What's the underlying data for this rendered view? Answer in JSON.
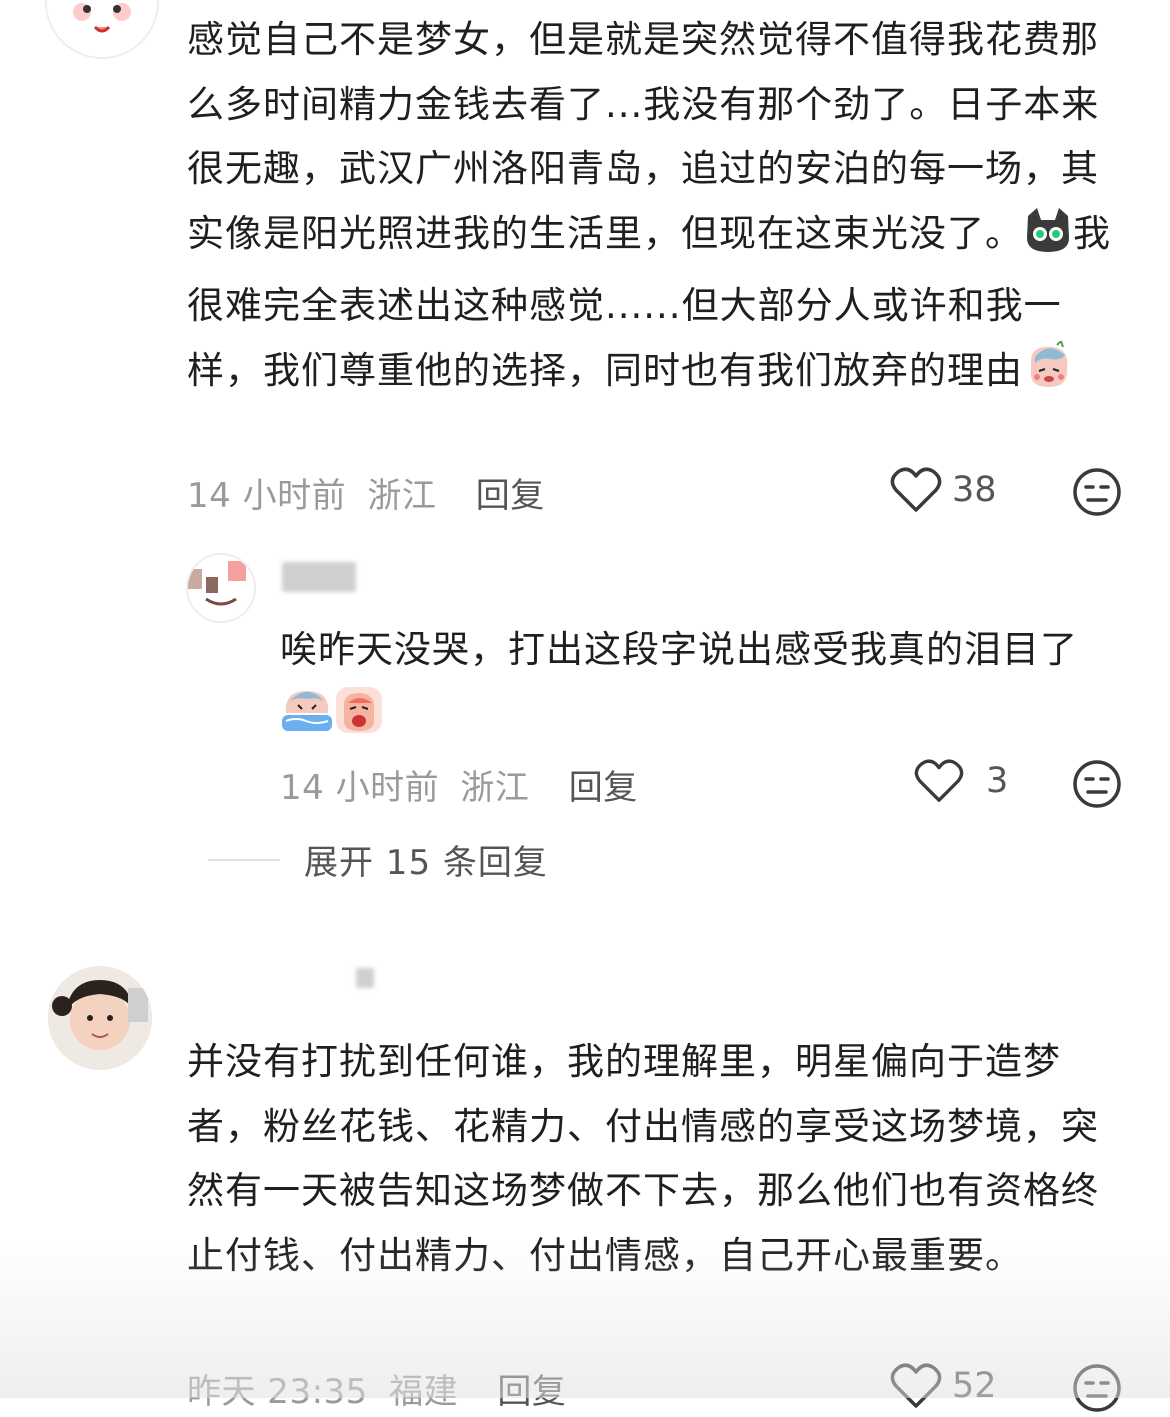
{
  "comment1": {
    "text_a": "感觉自己不是梦女，但是就是突然觉得不值得我花费那么多时间精力金钱去看了...我没有那个劲了。日子本来很无趣，武汉广州洛阳青岛，追过的安泊的每一场，其实像是阳光照进我的生活里，但现在这束光没了。",
    "text_b": "我很难完全表述出这种感觉......但大部分人或许和我一样，我们尊重他的选择，同时也有我们放弃的理由",
    "time": "14 小时前",
    "location": "浙江",
    "reply_label": "回复",
    "likes": "38",
    "like_icon": "heart-outline-icon",
    "dislike_icon": "neutral-face-icon"
  },
  "reply1": {
    "text": "唉昨天没哭，打出这段字说出感受我真的泪目了",
    "time": "14 小时前",
    "location": "浙江",
    "reply_label": "回复",
    "likes": "3"
  },
  "expand": {
    "label": "展开 15 条回复"
  },
  "comment2": {
    "text": "并没有打扰到任何谁，我的理解里，明星偏向于造梦者，粉丝花钱、花精力、付出情感的享受这场梦境，突然有一天被告知这场梦做不下去，那么他们也有资格终止付钱、付出精力、付出情感，自己开心最重要。",
    "time": "昨天 23:35",
    "location": "福建",
    "reply_label": "回复",
    "likes": "52"
  },
  "colors": {
    "text": "#1f1f1f",
    "meta": "#9a9a9a",
    "icon": "#3a3a3a"
  }
}
